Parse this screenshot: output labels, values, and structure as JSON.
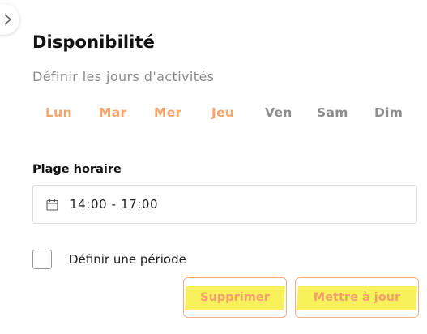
{
  "panel": {
    "title": "Disponibilité",
    "subtitle": "Définir les jours d'activités"
  },
  "days": [
    {
      "label": "Lun",
      "active": true
    },
    {
      "label": "Mar",
      "active": true
    },
    {
      "label": "Mer",
      "active": true
    },
    {
      "label": "Jeu",
      "active": true
    },
    {
      "label": "Ven",
      "active": false
    },
    {
      "label": "Sam",
      "active": false
    },
    {
      "label": "Dim",
      "active": false
    }
  ],
  "time_range": {
    "label": "Plage horaire",
    "value": "14:00 - 17:00",
    "icon": "calendar-icon"
  },
  "period": {
    "label": "Définir une période",
    "checked": false
  },
  "actions": {
    "delete_label": "Supprimer",
    "update_label": "Mettre à jour"
  },
  "colors": {
    "accent": "#f4a06a",
    "inactive_day": "#8c8c8c",
    "highlight": "#f7f25a"
  }
}
